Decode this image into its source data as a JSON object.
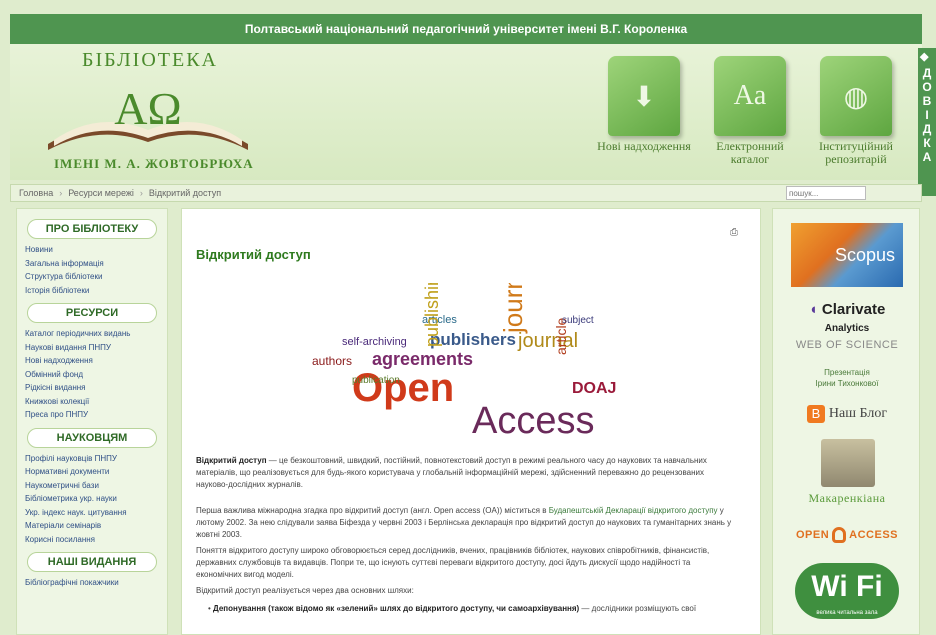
{
  "topbar": {
    "title": "Полтавський національний педагогічний університет імені В.Г. Короленка"
  },
  "logo": {
    "arc_text": "БІБЛІОТЕКА",
    "sub_text": "ІМЕНІ М. А. ЖОВТОБРЮХА"
  },
  "quick_links": [
    {
      "label": "Нові надходження",
      "icon": "download-arrow-icon"
    },
    {
      "label": "Електронний каталог",
      "icon": "letters-aa-icon"
    },
    {
      "label": "Інституційний репозитарій",
      "icon": "globe-icon"
    }
  ],
  "side_tab": {
    "label": "ДОВІДКА"
  },
  "breadcrumb": {
    "items": [
      "Головна",
      "Ресурси мережі",
      "Відкритий доступ"
    ]
  },
  "search": {
    "placeholder": "пошук..."
  },
  "sidebar": {
    "sections": [
      {
        "title": "ПРО БІБЛІОТЕКУ",
        "items": [
          "Новини",
          "Загальна інформація",
          "Структура бібліотеки",
          "Історія бібліотеки"
        ]
      },
      {
        "title": "РЕСУРСИ",
        "items": [
          "Каталог періодичних видань",
          "Наукові видання ПНПУ",
          "Нові надходження",
          "Обмінний фонд",
          "Рідкісні видання",
          "Книжкові колекції",
          "Преса про ПНПУ"
        ]
      },
      {
        "title": "НАУКОВЦЯМ",
        "items": [
          "Профілі науковців ПНПУ",
          "Нормативні документи",
          "Наукометричні бази",
          "Бібліометрика укр. науки",
          "Укр. індекс наук. цитування",
          "Матеріали семінарів",
          "Корисні посилання"
        ]
      },
      {
        "title": "НАШІ ВИДАННЯ",
        "items": [
          "Бібліографічні покажчики"
        ]
      }
    ]
  },
  "content": {
    "title": "Відкритий доступ",
    "cloud_words": [
      "Open",
      "Access",
      "journals",
      "agreements",
      "publishers",
      "journal",
      "publishing",
      "authors",
      "articles",
      "self-archiving",
      "DOAJ",
      "publication",
      "subject",
      "article"
    ],
    "p1_bold": "Відкритий доступ",
    "p1_text": " — це безкоштовний, швидкий, постійний, повнотекстовий доступ в режимі реального часу до наукових та навчальних матеріалів, що реалізовується для будь-якого користувача у глобальній інформаційній мережі, здійсненний переважно до рецензованих науково-дослідних журналів.",
    "p2_text_a": "Перша важлива міжнародна згадка про відкритий доступ (англ. Open access (OA)) міститься в ",
    "p2_link": "Будапештській Декларації відкритого доступу",
    "p2_text_b": " у лютому 2002. За нею слідували заява Біфезда у червні 2003 і Берлінська декларація про відкритий доступ до наукових та гуманітарних знань у жовтні 2003.",
    "p3_text": "Поняття відкритого доступу широко обговорюється серед дослідників, вчених, працівників бібліотек, наукових співробітників, фінансистів, державних службовців та видавців. Попри те, що існують суттєві переваги відкритого доступу, досі йдуть дискусії щодо надійності та економічних вигод моделі.",
    "p4_text": "Відкритий доступ реалізується через два основних шляхи:",
    "p5_bold": "Депонування (також відомо як «зелений» шлях до відкритого доступу, чи самоархівування)",
    "p5_text": " — дослідники розміщують свої"
  },
  "rightbar": {
    "scopus_label": "Scopus",
    "clarivate_label": "Clarivate",
    "analytics_label": "Analytics",
    "wos_label": "WEB OF SCIENCE",
    "presentation_line1": "Презентація",
    "presentation_line2": "Ірини Тихонкової",
    "blog_label": "Наш Блог",
    "makarenkiana_label": "Макаренкіана",
    "open_label": "OPEN",
    "access_label": "ACCESS",
    "wifi_label": "Wi Fi",
    "wifi_sub": "велика читальна зала"
  }
}
